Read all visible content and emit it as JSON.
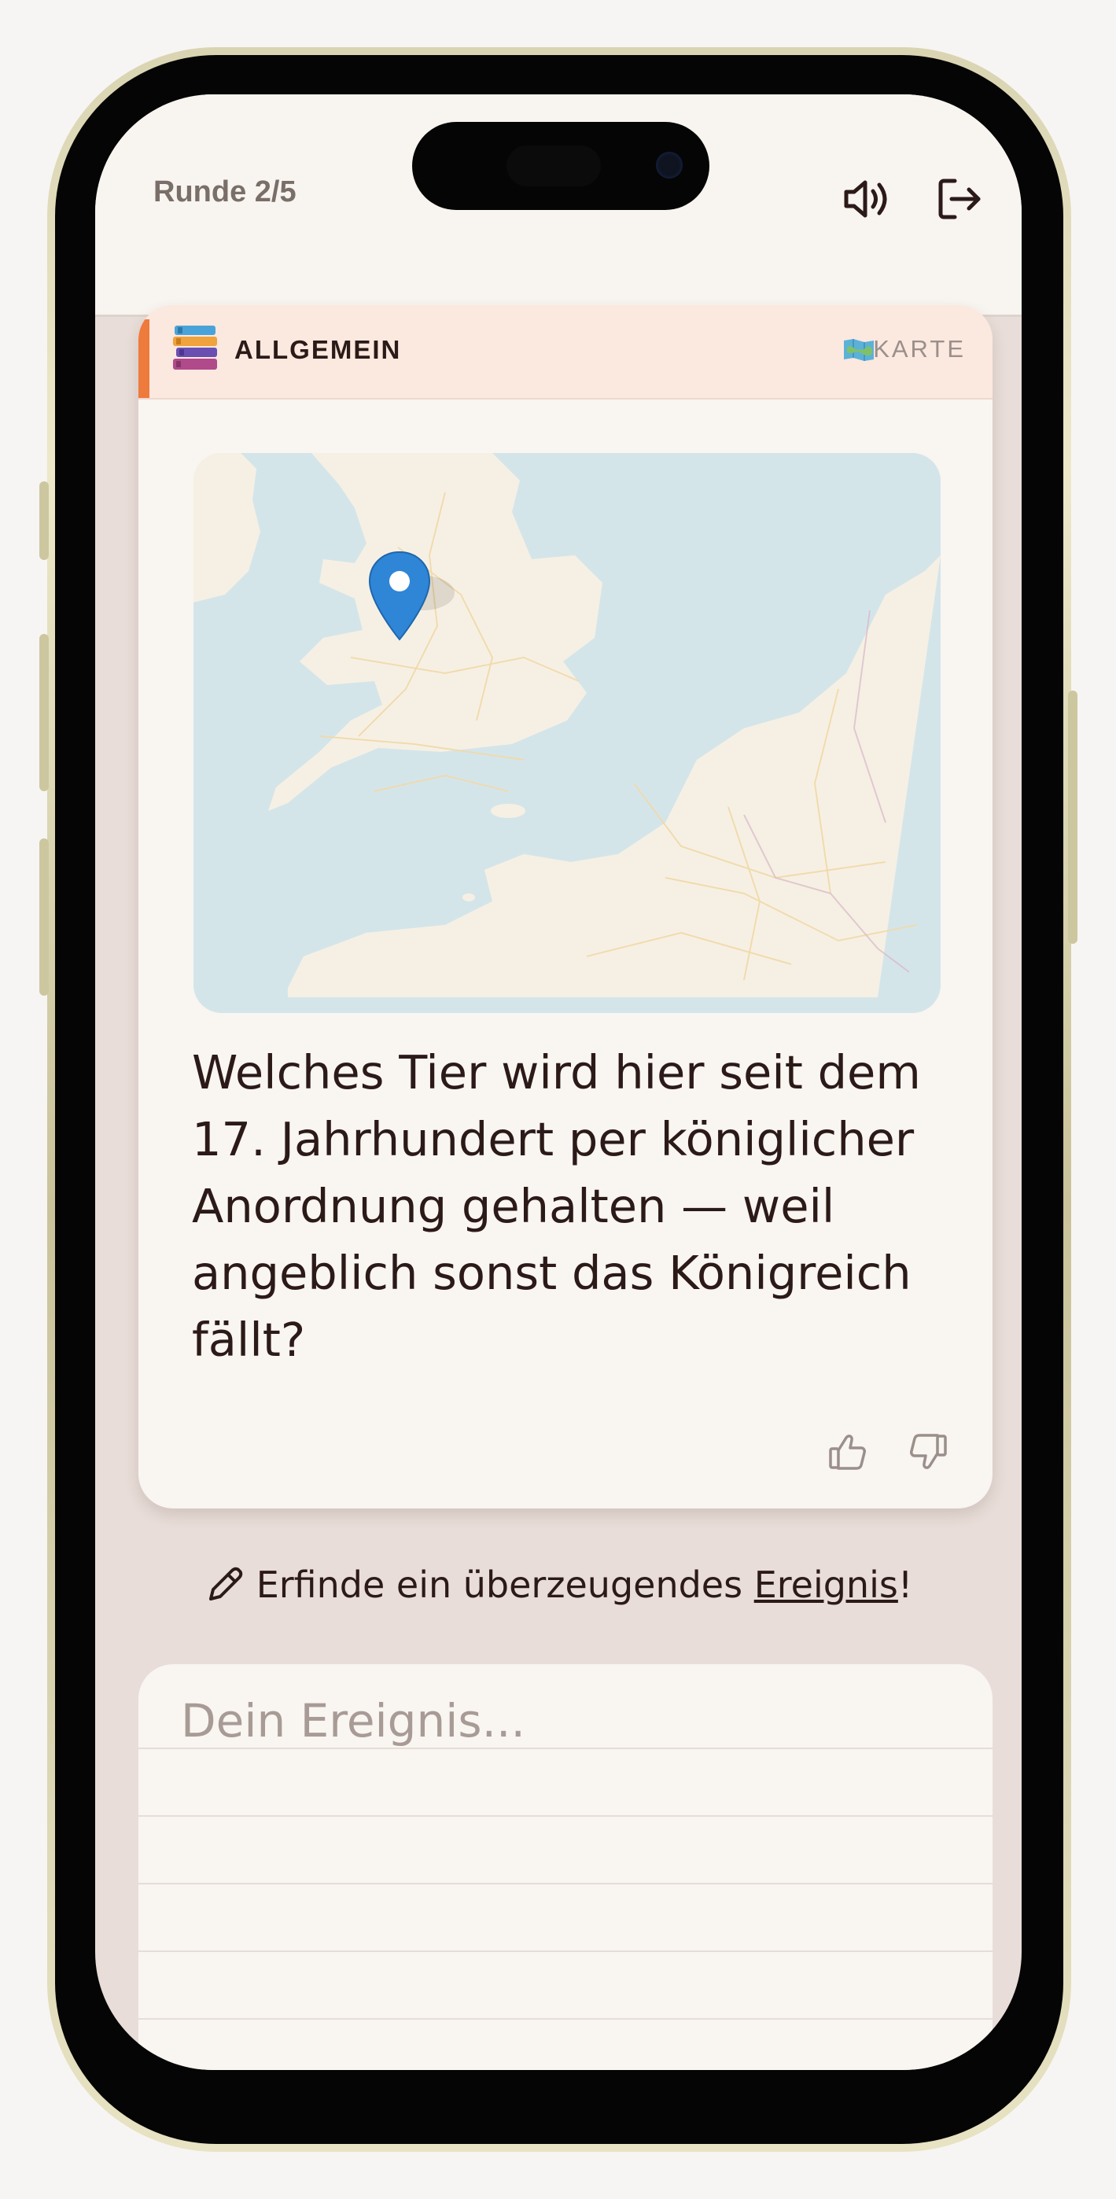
{
  "header": {
    "round_label": "Runde 2/5",
    "icons": [
      "speaker-icon",
      "exit-icon"
    ]
  },
  "card": {
    "category_label": "ALLGEMEIN",
    "category_icon": "books-icon",
    "type_label": "KARTE",
    "type_icon": "map-icon",
    "accent_color": "#ee7a3c",
    "question": "Welches Tier wird hier seit dem 17. Jahrhundert per königlicher Anordnung gehalten — weil angeblich sonst das Königreich fällt?",
    "rating_icons": [
      "thumbs-up-icon",
      "thumbs-down-icon"
    ]
  },
  "hint": {
    "prefix": "Erfinde ein überzeugendes ",
    "link": "Ereignis",
    "suffix": "!"
  },
  "input": {
    "placeholder": "Dein Ereignis..."
  },
  "colors": {
    "background": "#e8ddd8",
    "card": "#f9f5f1",
    "text": "#2b1a18",
    "pin": "#2f86d6"
  }
}
